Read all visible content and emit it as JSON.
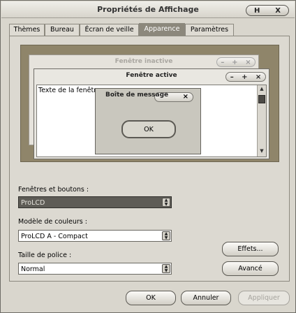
{
  "window": {
    "title": "Propriétés de Affichage",
    "controls": [
      "H",
      "X"
    ]
  },
  "tabs": [
    {
      "label": "Thèmes"
    },
    {
      "label": "Bureau"
    },
    {
      "label": "Écran de veille"
    },
    {
      "label": "Apparence",
      "active": true
    },
    {
      "label": "Paramètres"
    }
  ],
  "preview": {
    "inactive_title": "Fenêtre inactive",
    "active_title": "Fenêtre active",
    "window_text": "Texte de la fenêtre",
    "window_controls": [
      "–",
      "+",
      "×"
    ],
    "message_title": "Boîte de message",
    "message_close": "×",
    "ok_label": "OK"
  },
  "fields": {
    "windows_buttons": {
      "label": "Fenêtres et boutons :",
      "value": "ProLCD"
    },
    "color_scheme": {
      "label": "Modèle de couleurs :",
      "value": "ProLCD A - Compact"
    },
    "font_size": {
      "label": "Taille de police :",
      "value": "Normal"
    }
  },
  "buttons": {
    "effects": "Effets...",
    "advanced": "Avancé",
    "ok": "OK",
    "cancel": "Annuler",
    "apply": "Appliquer"
  },
  "colors": {
    "preview_background": "#8f856a",
    "active_tab": "#8c887c"
  }
}
